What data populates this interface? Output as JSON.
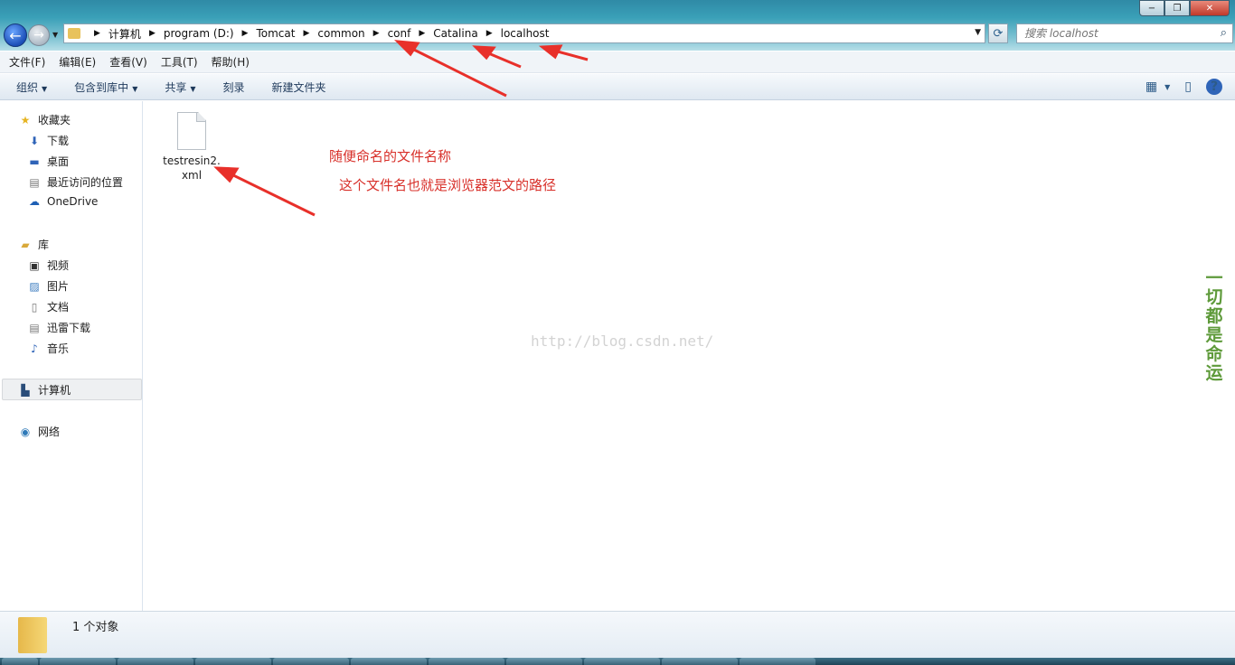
{
  "window": {
    "min": "−",
    "max": "❐",
    "close": "✕"
  },
  "breadcrumbs": [
    "计算机",
    "program (D:)",
    "Tomcat",
    "common",
    "conf",
    "Catalina",
    "localhost"
  ],
  "search": {
    "placeholder": "搜索 localhost"
  },
  "menu": [
    "文件(F)",
    "编辑(E)",
    "查看(V)",
    "工具(T)",
    "帮助(H)"
  ],
  "commands": {
    "organize": "组织",
    "include": "包含到库中",
    "share": "共享",
    "burn": "刻录",
    "new_folder": "新建文件夹",
    "help": "?"
  },
  "nav": {
    "favorites": "收藏夹",
    "downloads": "下载",
    "desktop": "桌面",
    "recent": "最近访问的位置",
    "onedrive": "OneDrive",
    "libraries": "库",
    "videos": "视频",
    "pictures": "图片",
    "documents": "文档",
    "thunder": "迅雷下载",
    "music": "音乐",
    "computer": "计算机",
    "network": "网络"
  },
  "file": {
    "name": "testresin2.xml"
  },
  "annotations": {
    "line1": "随便命名的文件名称",
    "line2": "这个文件名也就是浏览器范文的路径"
  },
  "watermark": "http://blog.csdn.net/",
  "side_stamp": "一切都是命运",
  "status": {
    "count": "1 个对象"
  },
  "colors": {
    "annotation": "#d8302a",
    "accent": "#2f8aa6"
  }
}
